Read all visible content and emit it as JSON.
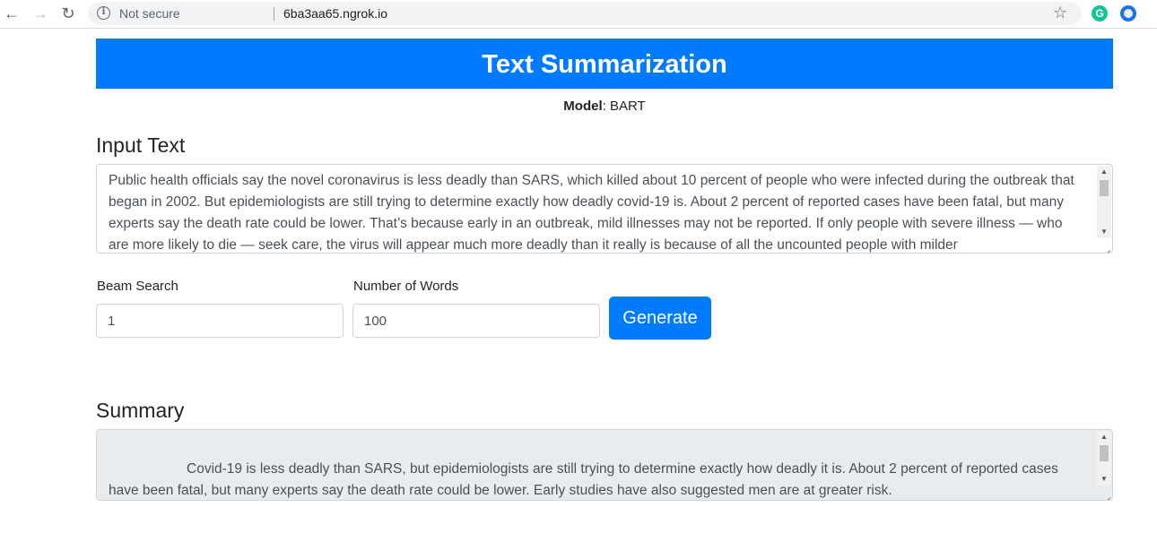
{
  "browser": {
    "security_label": "Not secure",
    "url": "6ba3aa65.ngrok.io",
    "extension_1_letter": "G"
  },
  "page": {
    "title": "Text Summarization",
    "model_label": "Model",
    "model_value": ": BART",
    "input_heading": "Input Text",
    "input_text": "Public health officials say the novel coronavirus is less deadly than SARS, which killed about 10 percent of people who were infected during the outbreak that began in 2002. But epidemiologists are still trying to determine exactly how deadly covid-19 is. About 2 percent of reported cases have been fatal, but many experts say the death rate could be lower. That’s because early in an outbreak, mild illnesses may not be reported. If only people with severe illness — who are more likely to die — seek care, the virus will appear much more deadly than it really is because of all the uncounted people with milder",
    "beam_label": "Beam Search",
    "beam_value": "1",
    "words_label": "Number of Words",
    "words_value": "100",
    "generate_label": "Generate",
    "summary_heading": "Summary",
    "summary_text": "Covid-19 is less deadly than SARS, but epidemiologists are still trying to determine exactly how deadly it is. About 2 percent of reported cases have been fatal, but many experts say the death rate could be lower. Early studies have also suggested men are at greater risk."
  }
}
